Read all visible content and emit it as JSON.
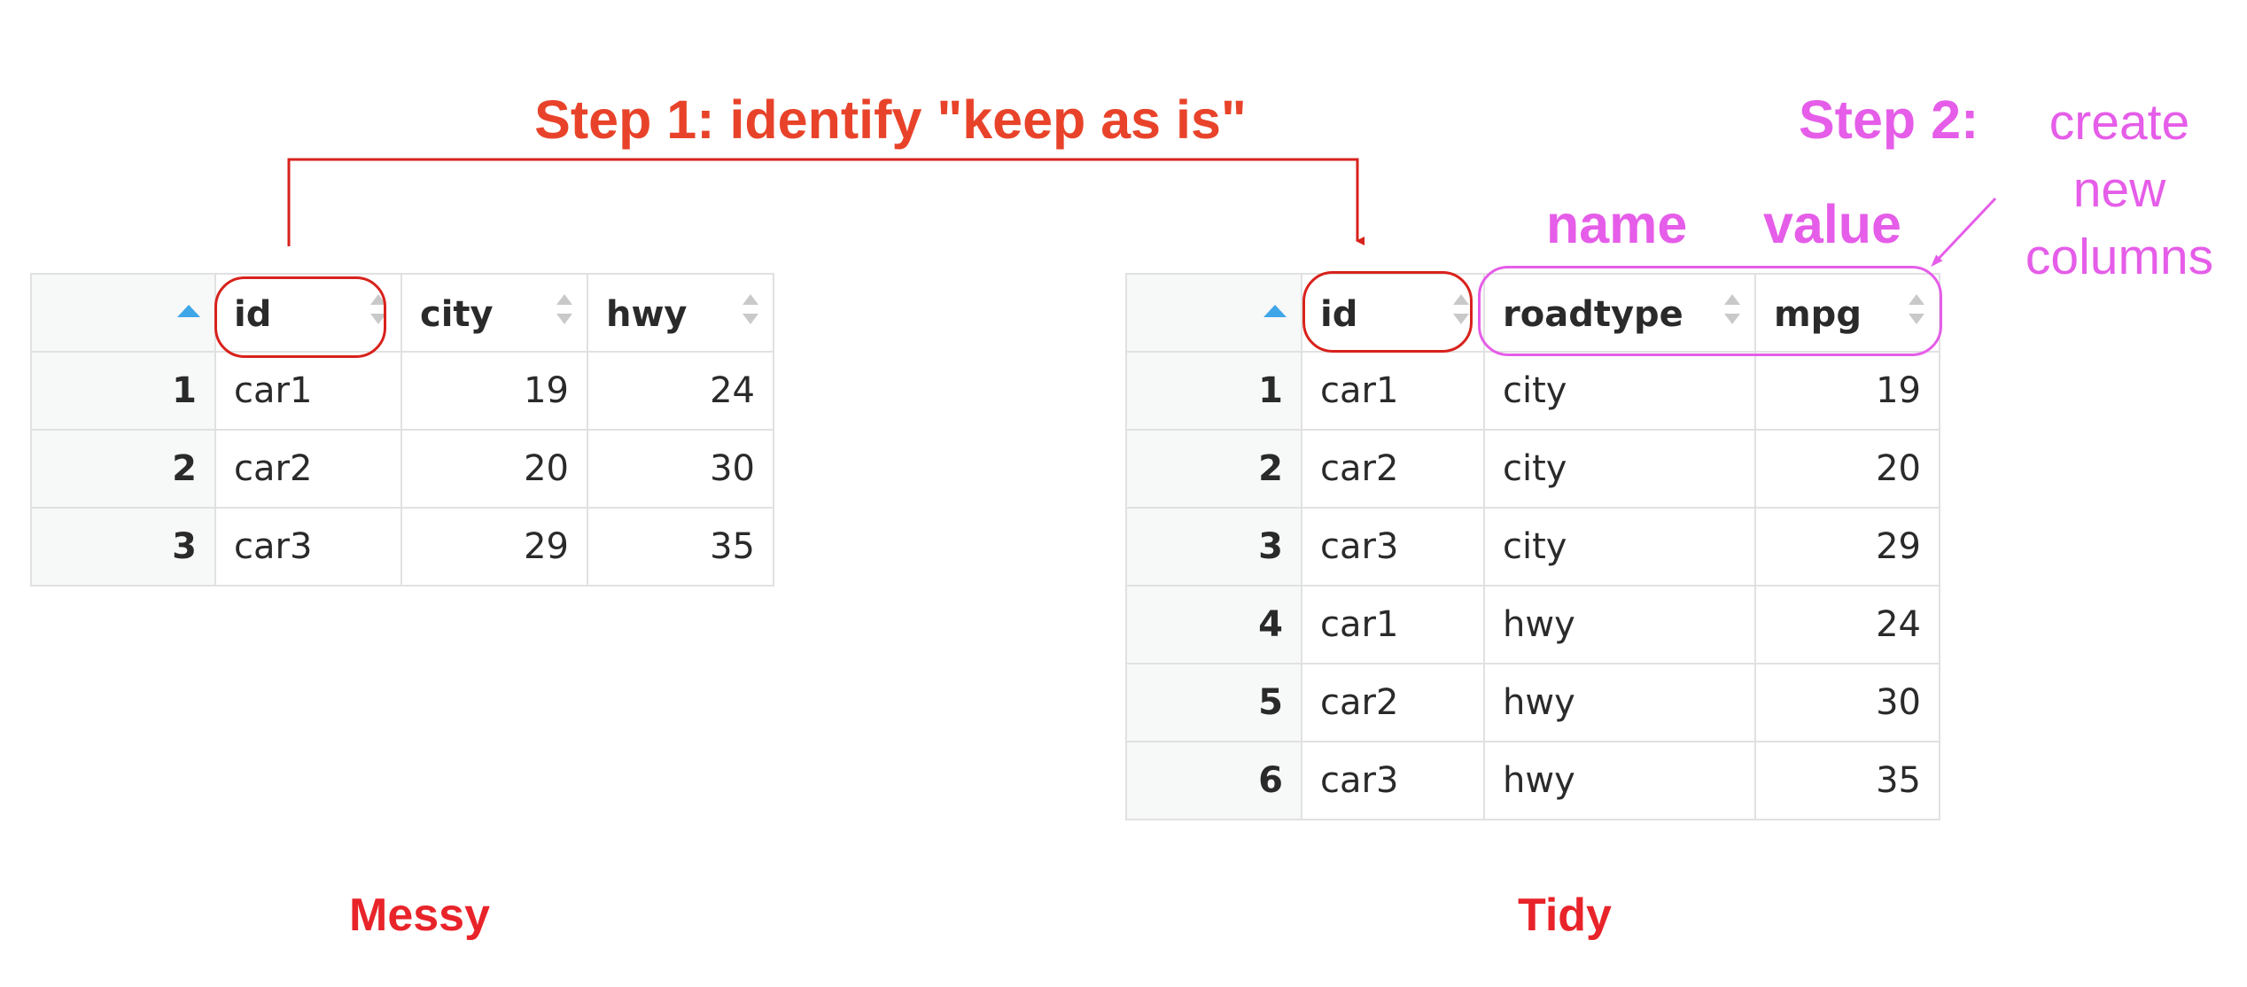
{
  "annotations": {
    "step1": "Step 1: identify \"keep as is\"",
    "step2": "Step 2:",
    "create_lines": [
      "create",
      "new",
      "columns"
    ],
    "name_label": "name",
    "value_label": "value",
    "messy_caption": "Messy",
    "tidy_caption": "Tidy"
  },
  "colors": {
    "step1_red": "#e8432a",
    "step2_pink": "#e55de8",
    "caption_red": "#e8242a",
    "sort_asc_blue": "#3fa6e8"
  },
  "messy_table": {
    "columns": [
      "id",
      "city",
      "hwy"
    ],
    "rows": [
      {
        "n": "1",
        "id": "car1",
        "city": "19",
        "hwy": "24"
      },
      {
        "n": "2",
        "id": "car2",
        "city": "20",
        "hwy": "30"
      },
      {
        "n": "3",
        "id": "car3",
        "city": "29",
        "hwy": "35"
      }
    ]
  },
  "tidy_table": {
    "columns": [
      "id",
      "roadtype",
      "mpg"
    ],
    "rows": [
      {
        "n": "1",
        "id": "car1",
        "roadtype": "city",
        "mpg": "19"
      },
      {
        "n": "2",
        "id": "car2",
        "roadtype": "city",
        "mpg": "20"
      },
      {
        "n": "3",
        "id": "car3",
        "roadtype": "city",
        "mpg": "29"
      },
      {
        "n": "4",
        "id": "car1",
        "roadtype": "hwy",
        "mpg": "24"
      },
      {
        "n": "5",
        "id": "car2",
        "roadtype": "hwy",
        "mpg": "30"
      },
      {
        "n": "6",
        "id": "car3",
        "roadtype": "hwy",
        "mpg": "35"
      }
    ]
  }
}
